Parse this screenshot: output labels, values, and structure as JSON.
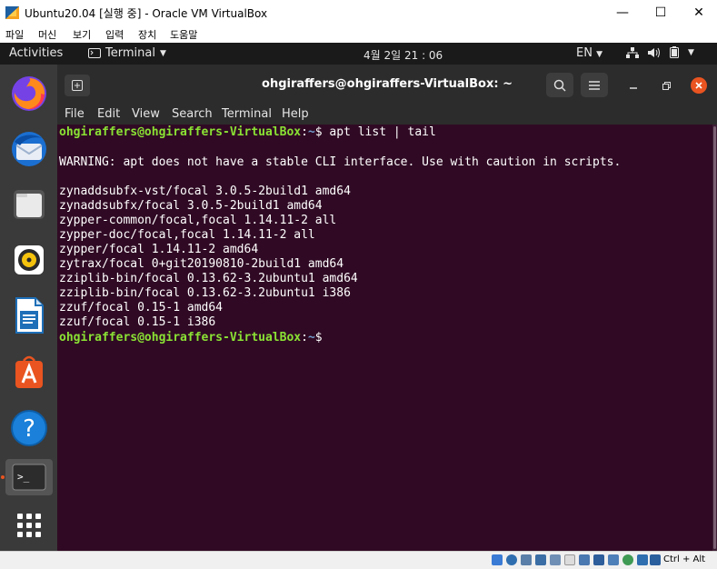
{
  "host_window": {
    "title": "Ubuntu20.04 [실행 중] - Oracle VM VirtualBox",
    "menu": [
      "파일",
      "머신",
      "보기",
      "입력",
      "장치",
      "도움말"
    ],
    "controls": {
      "minimize": "—",
      "maximize": "☐",
      "close": "✕"
    }
  },
  "gnome_topbar": {
    "activities": "Activities",
    "app_menu": "Terminal",
    "clock": "4월 2일  21 : 06",
    "input_source": "EN"
  },
  "dock": {
    "items": [
      "firefox-icon",
      "thunderbird-icon",
      "files-icon",
      "rhythmbox-icon",
      "libreoffice-writer-icon",
      "ubuntu-software-icon",
      "help-icon",
      "terminal-icon",
      "show-applications-icon"
    ]
  },
  "terminal": {
    "title": "ohgiraffers@ohgiraffers-VirtualBox: ~",
    "menu": [
      "File",
      "Edit",
      "View",
      "Search",
      "Terminal",
      "Help"
    ],
    "prompt_user": "ohgiraffers@ohgiraffers-VirtualBox",
    "prompt_path": "~",
    "command": "apt list | tail",
    "warning": "WARNING: apt does not have a stable CLI interface. Use with caution in scripts.",
    "output": [
      "zynaddsubfx-vst/focal 3.0.5-2build1 amd64",
      "zynaddsubfx/focal 3.0.5-2build1 amd64",
      "zypper-common/focal,focal 1.14.11-2 all",
      "zypper-doc/focal,focal 1.14.11-2 all",
      "zypper/focal 1.14.11-2 amd64",
      "zytrax/focal 0+git20190810-2build1 amd64",
      "zziplib-bin/focal 0.13.62-3.2ubuntu1 amd64",
      "zziplib-bin/focal 0.13.62-3.2ubuntu1 i386",
      "zzuf/focal 0.15-1 amd64",
      "zzuf/focal 0.15-1 i386"
    ],
    "colors": {
      "background": "#300a24",
      "prompt_user": "#8ae234",
      "prompt_path": "#729fcf"
    }
  },
  "status_bar": {
    "host_key": "Ctrl + Alt"
  }
}
